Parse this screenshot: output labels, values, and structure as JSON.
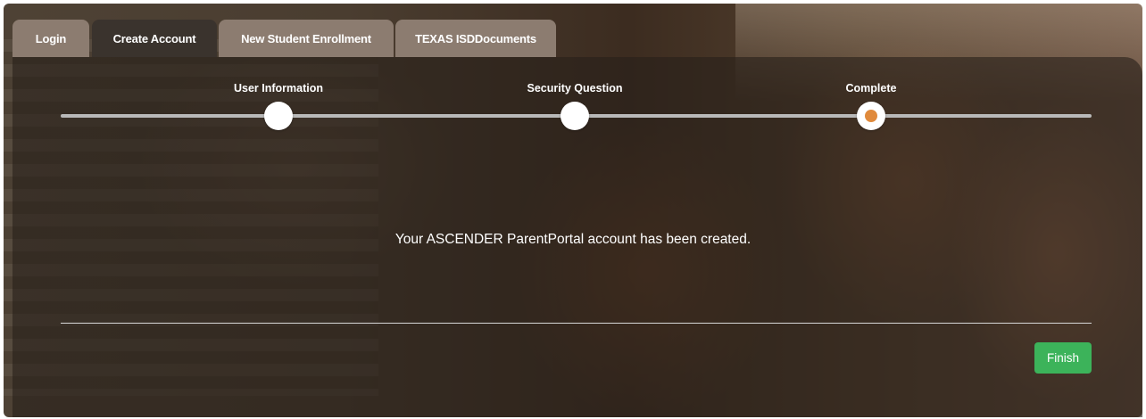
{
  "tabs": [
    {
      "label": "Login"
    },
    {
      "label": "Create Account"
    },
    {
      "label": "New Student Enrollment"
    },
    {
      "label": "TEXAS ISDDocuments"
    }
  ],
  "active_tab": "Create Account",
  "steps": [
    {
      "label": "User Information",
      "state": "done"
    },
    {
      "label": "Security Question",
      "state": "done"
    },
    {
      "label": "Complete",
      "state": "current"
    }
  ],
  "message": "Your ASCENDER ParentPortal account has been created.",
  "finish_button": "Finish",
  "colors": {
    "tab": "#8c7c70",
    "tab_active": "#3a332d",
    "progress_track": "#b9b9b9",
    "current_step": "#e08a3c",
    "finish": "#3cb35a"
  }
}
